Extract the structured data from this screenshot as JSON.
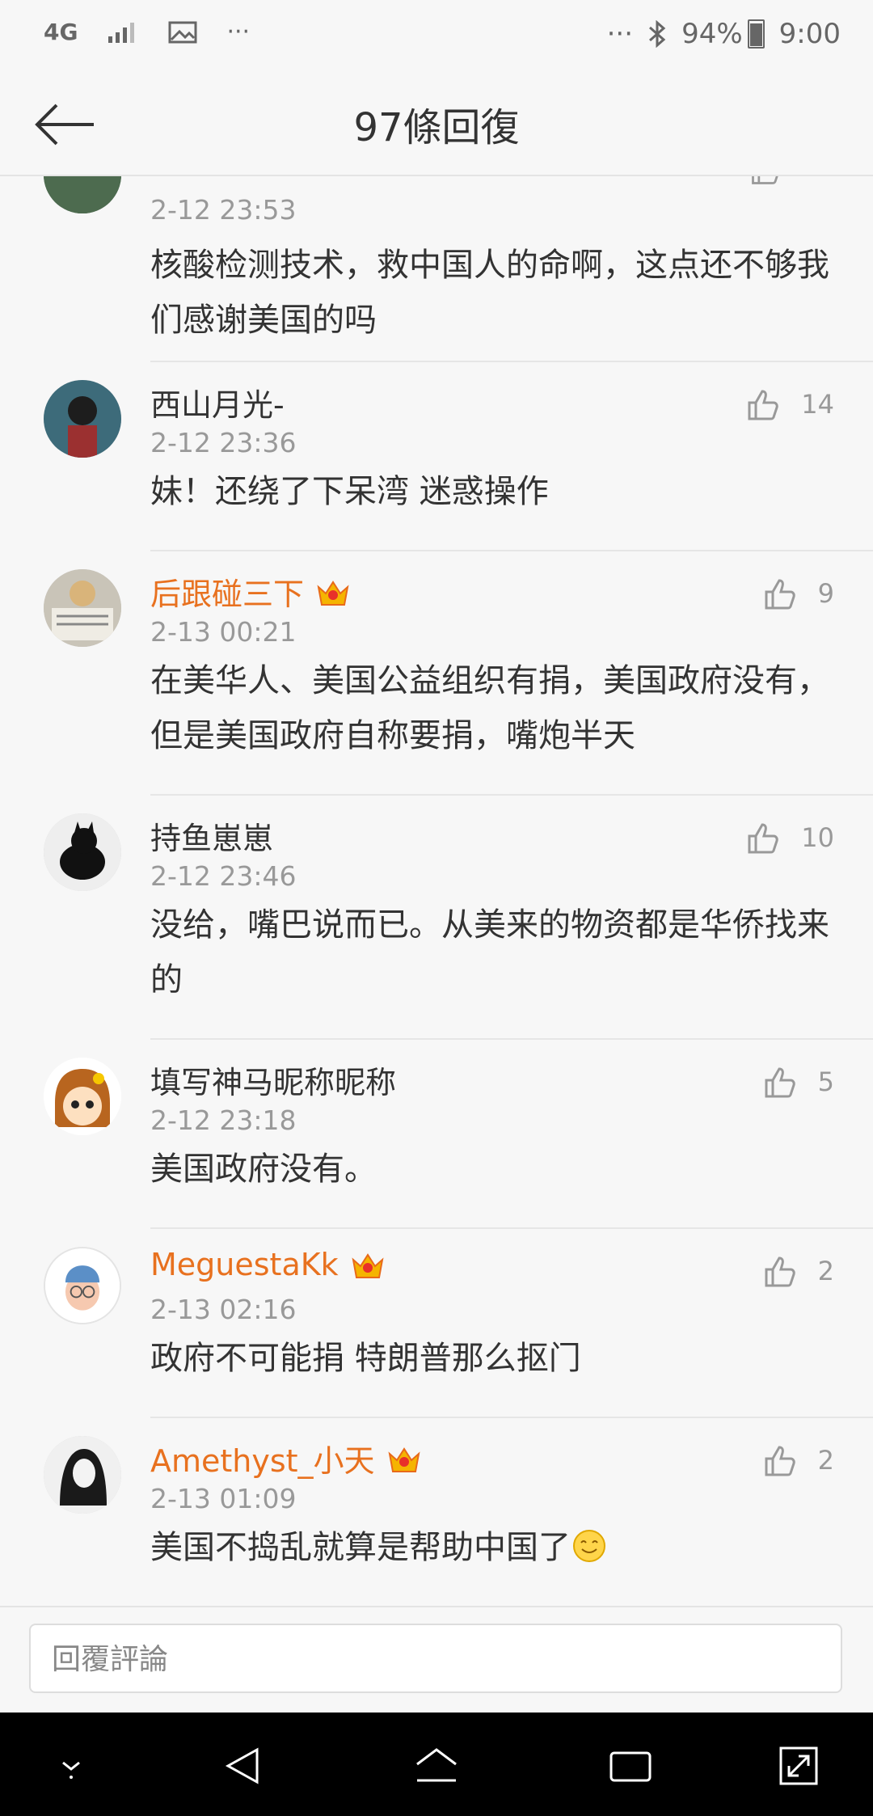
{
  "status_bar": {
    "network": "4G",
    "more_left": "···",
    "more_right": "···",
    "battery": "94%",
    "time": "9:00"
  },
  "header": {
    "title": "97條回復"
  },
  "comments": [
    {
      "name": "",
      "time": "2-12 23:53",
      "text": "核酸检测技术，救中国人的命啊，这点还不够我们感谢美国的吗",
      "likes": ""
    },
    {
      "name": "西山月光-",
      "time": "2-12 23:36",
      "text": "妹！还绕了下呆湾 迷惑操作",
      "likes": "14"
    },
    {
      "name": "后跟碰三下",
      "time": "2-13 00:21",
      "text": "在美华人、美国公益组织有捐，美国政府没有，但是美国政府自称要捐，嘴炮半天",
      "likes": "9"
    },
    {
      "name": "持鱼崽崽",
      "time": "2-12 23:46",
      "text": "没给，嘴巴说而已。从美来的物资都是华侨找来的",
      "likes": "10"
    },
    {
      "name": "填写神马昵称昵称",
      "time": "2-12 23:18",
      "text": "美国政府没有。",
      "likes": "5"
    },
    {
      "name": "MeguestaKk",
      "time": "2-13 02:16",
      "text": "政府不可能捐 特朗普那么抠门",
      "likes": "2"
    },
    {
      "name": "Amethyst_小天",
      "time": "2-13 01:09",
      "text": "美国不捣乱就算是帮助中国了",
      "likes": "2"
    }
  ],
  "input": {
    "placeholder": "回覆評論"
  },
  "colors": {
    "vip_name": "#e8711f",
    "muted": "#999999",
    "background": "#f7f7f7"
  }
}
